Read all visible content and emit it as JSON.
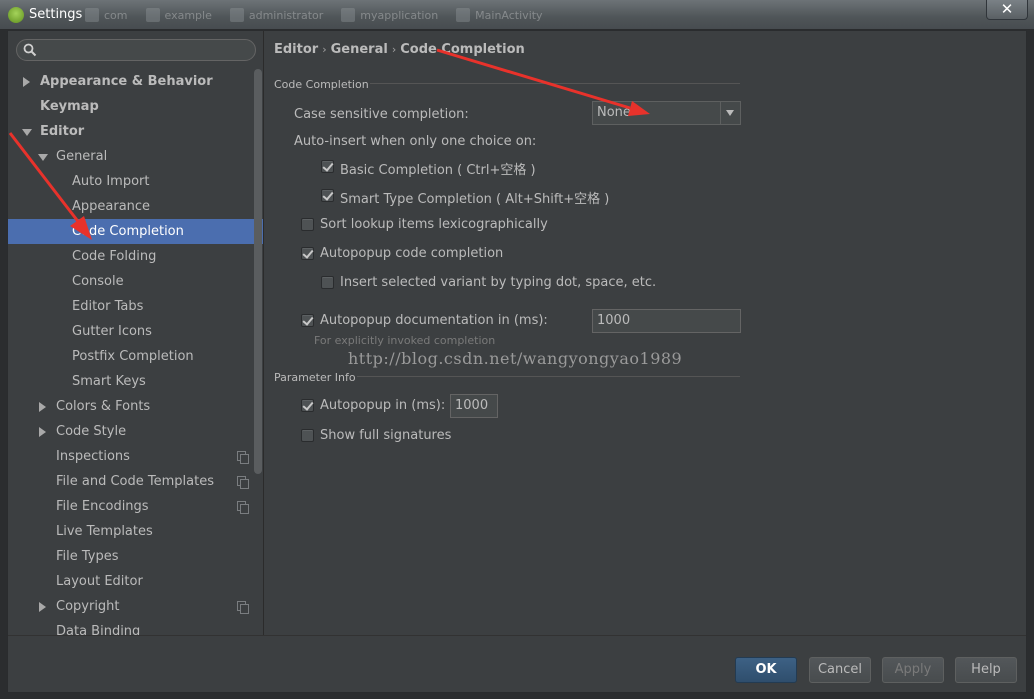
{
  "window": {
    "title": "Settings",
    "background_tabs": [
      "com",
      "example",
      "administrator",
      "myapplication",
      "MainActivity"
    ],
    "close_symbol": "✕"
  },
  "sidebar": {
    "search_placeholder": "",
    "items": [
      {
        "label": "Appearance & Behavior"
      },
      {
        "label": "Keymap"
      },
      {
        "label": "Editor"
      },
      {
        "label": "General"
      },
      {
        "label": "Auto Import"
      },
      {
        "label": "Appearance"
      },
      {
        "label": "Code Completion"
      },
      {
        "label": "Code Folding"
      },
      {
        "label": "Console"
      },
      {
        "label": "Editor Tabs"
      },
      {
        "label": "Gutter Icons"
      },
      {
        "label": "Postfix Completion"
      },
      {
        "label": "Smart Keys"
      },
      {
        "label": "Colors & Fonts"
      },
      {
        "label": "Code Style"
      },
      {
        "label": "Inspections"
      },
      {
        "label": "File and Code Templates"
      },
      {
        "label": "File Encodings"
      },
      {
        "label": "Live Templates"
      },
      {
        "label": "File Types"
      },
      {
        "label": "Layout Editor"
      },
      {
        "label": "Copyright"
      },
      {
        "label": "Data Binding"
      }
    ]
  },
  "breadcrumb": [
    "Editor",
    "General",
    "Code Completion"
  ],
  "breadcrumb_sep": "›",
  "code_completion": {
    "section_title": "Code Completion",
    "case_sensitive_label": "Case sensitive completion:",
    "case_sensitive_value": "None",
    "auto_insert_label": "Auto-insert when only one choice on:",
    "basic_completion": {
      "label": "Basic Completion ( Ctrl+空格 )",
      "checked": true
    },
    "smart_type_completion": {
      "label": "Smart Type Completion ( Alt+Shift+空格 )",
      "checked": true
    },
    "sort_lookup": {
      "label": "Sort lookup items lexicographically",
      "checked": false
    },
    "autopopup_code": {
      "label": "Autopopup code completion",
      "checked": true
    },
    "insert_selected": {
      "label": "Insert selected variant by typing dot, space, etc.",
      "checked": false
    },
    "autopopup_doc": {
      "label": "Autopopup documentation in (ms):",
      "checked": true,
      "value": "1000"
    },
    "autopopup_doc_hint": "For explicitly invoked completion"
  },
  "watermark": "http://blog.csdn.net/wangyongyao1989",
  "parameter_info": {
    "section_title": "Parameter Info",
    "autopopup": {
      "label": "Autopopup in (ms):",
      "checked": true,
      "value": "1000"
    },
    "show_full_signatures": {
      "label": "Show full signatures",
      "checked": false
    }
  },
  "footer": {
    "ok": "OK",
    "cancel": "Cancel",
    "apply": "Apply",
    "help": "Help"
  },
  "colors": {
    "selection": "#4b6eaf",
    "panel": "#3c3f41",
    "annotation_arrow": "#e8322b"
  }
}
